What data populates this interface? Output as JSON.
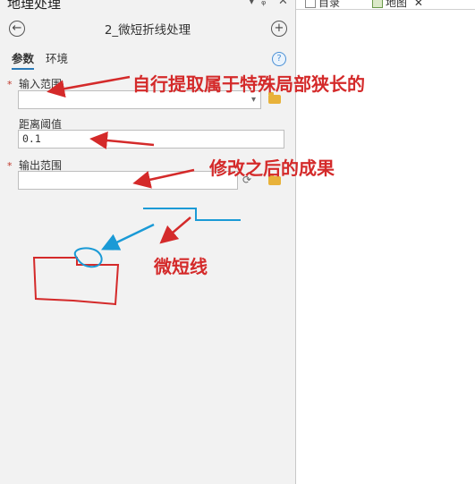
{
  "pane": {
    "title": "地理处理",
    "pin_glyph": "ᵩ",
    "close_glyph": "✕",
    "tool_title": "2_微短折线处理",
    "back_glyph": "←",
    "add_glyph": "+",
    "tabs": [
      {
        "label": "参数"
      },
      {
        "label": "环境"
      }
    ],
    "help_glyph": "?"
  },
  "params": {
    "input": {
      "label": "输入范围",
      "value": ""
    },
    "distance": {
      "label": "距离阈值",
      "value": "0.1"
    },
    "output": {
      "label": "输出范围",
      "value": ""
    }
  },
  "map_tabs": [
    {
      "label": "目录"
    },
    {
      "label": "地图"
    }
  ],
  "annotations": {
    "input_note": "自行提取属于特殊局部狭长的",
    "output_note": "修改之后的成果",
    "shape_note": "微短线"
  },
  "colors": {
    "annot_red": "#d42a2a",
    "annot_blue": "#1a9ad6",
    "accent": "#2a7ab8"
  }
}
